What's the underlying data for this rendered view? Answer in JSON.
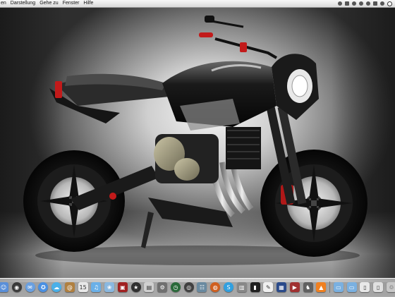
{
  "menubar": {
    "items": [
      "en",
      "Darstellung",
      "Gehe zu",
      "Fenster",
      "Hilfe"
    ]
  },
  "desktop": {
    "wallpaper_subject": "black naked motorcycle in studio"
  },
  "dock": {
    "apps": [
      {
        "name": "finder-icon",
        "color": "#5a8fd8",
        "glyph": "☺"
      },
      {
        "name": "dashboard-icon",
        "color": "#3a3a3a",
        "glyph": "◉"
      },
      {
        "name": "mail-icon",
        "color": "#6aa0e0",
        "glyph": "✉"
      },
      {
        "name": "safari-icon",
        "color": "#4a90e2",
        "glyph": "✪"
      },
      {
        "name": "ichat-icon",
        "color": "#4ab0e8",
        "glyph": "☁"
      },
      {
        "name": "address-book-icon",
        "color": "#b08040",
        "glyph": "@"
      },
      {
        "name": "ical-icon",
        "color": "#e8e8e8",
        "glyph": "15"
      },
      {
        "name": "itunes-icon",
        "color": "#6ab0e8",
        "glyph": "♫"
      },
      {
        "name": "iphoto-icon",
        "color": "#8ab8e0",
        "glyph": "❀"
      },
      {
        "name": "photo-booth-icon",
        "color": "#a02020",
        "glyph": "▣"
      },
      {
        "name": "front-row-icon",
        "color": "#303030",
        "glyph": "★"
      },
      {
        "name": "preview-icon",
        "color": "#d0d0d0",
        "glyph": "▤"
      },
      {
        "name": "system-preferences-icon",
        "color": "#707070",
        "glyph": "⚙"
      },
      {
        "name": "time-machine-icon",
        "color": "#2a6a3a",
        "glyph": "◷"
      },
      {
        "name": "camera-icon",
        "color": "#404040",
        "glyph": "◎"
      },
      {
        "name": "network-icon",
        "color": "#6a8aa0",
        "glyph": "☷"
      },
      {
        "name": "firefox-icon",
        "color": "#d06020",
        "glyph": "◍"
      },
      {
        "name": "skype-icon",
        "color": "#30a0e0",
        "glyph": "S"
      },
      {
        "name": "utility-icon",
        "color": "#888888",
        "glyph": "▥"
      },
      {
        "name": "terminal-icon",
        "color": "#202020",
        "glyph": "▮"
      },
      {
        "name": "textedit-icon",
        "color": "#f0f0f0",
        "glyph": "✎"
      },
      {
        "name": "photoshop-icon",
        "color": "#2a4a8a",
        "glyph": "▦"
      },
      {
        "name": "media-icon",
        "color": "#a03030",
        "glyph": "▶"
      },
      {
        "name": "chess-icon",
        "color": "#606060",
        "glyph": "♞"
      },
      {
        "name": "vlc-icon",
        "color": "#f08020",
        "glyph": "▲"
      },
      {
        "name": "documents-folder-icon",
        "color": "#7ab0e0",
        "glyph": "▭"
      },
      {
        "name": "downloads-folder-icon",
        "color": "#7ab0e0",
        "glyph": "▭"
      },
      {
        "name": "document-stack-icon",
        "color": "#e8e8e8",
        "glyph": "▯"
      },
      {
        "name": "document-stack-icon-2",
        "color": "#e0e0e0",
        "glyph": "▯"
      },
      {
        "name": "trash-icon",
        "color": "#c8c8c8",
        "glyph": "♲"
      }
    ]
  }
}
